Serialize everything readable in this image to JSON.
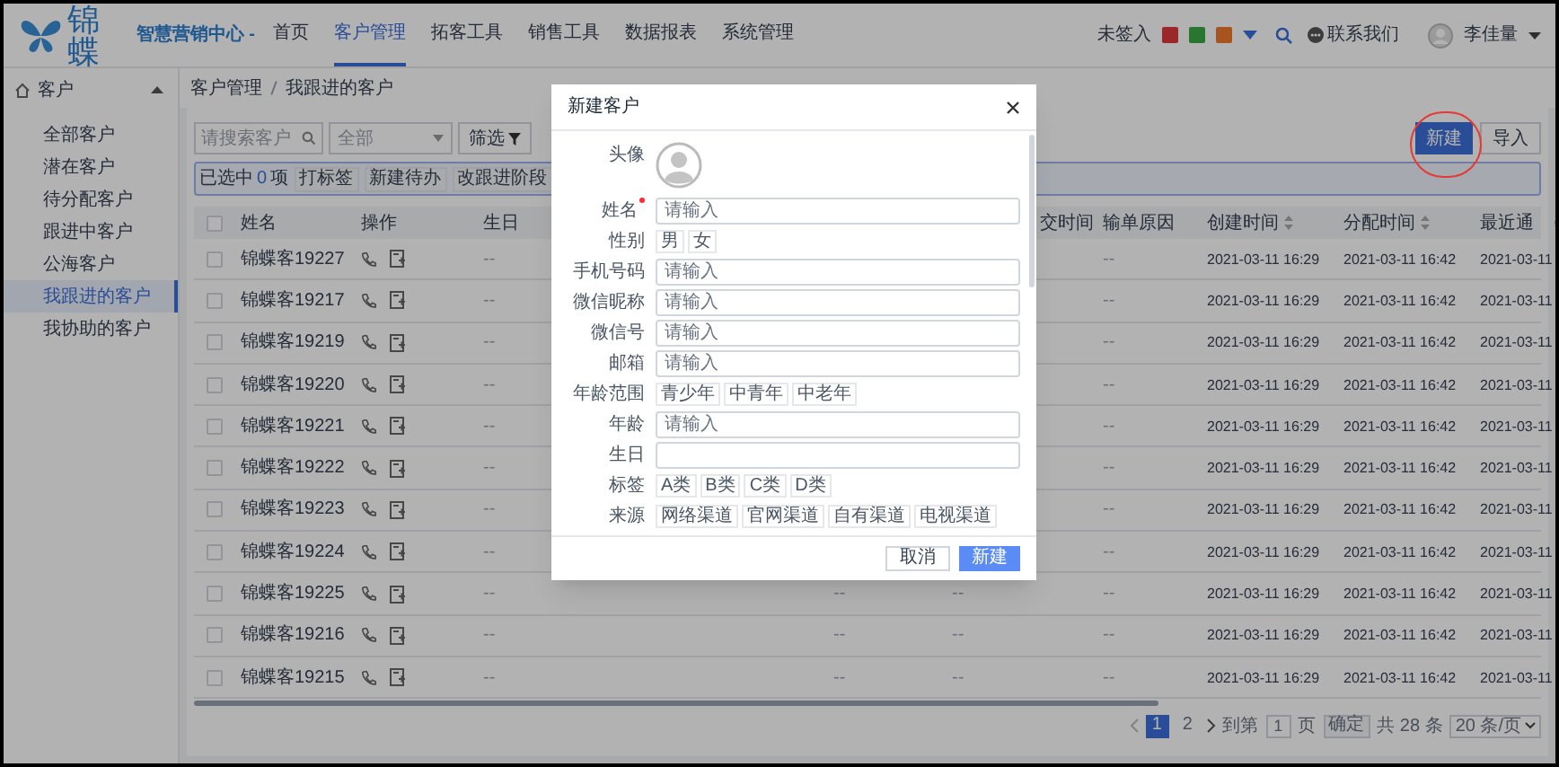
{
  "app": {
    "logo_text": "锦蝶",
    "product": "智慧营销中心 -"
  },
  "nav": [
    {
      "label": "首页",
      "selected": false
    },
    {
      "label": "客户管理",
      "selected": true
    },
    {
      "label": "拓客工具",
      "selected": false
    },
    {
      "label": "销售工具",
      "selected": false
    },
    {
      "label": "数据报表",
      "selected": false
    },
    {
      "label": "系统管理",
      "selected": false
    }
  ],
  "header_right": {
    "sign_status": "未签入",
    "quick_icons": [
      {
        "color": "#9d282b"
      },
      {
        "color": "#297630"
      },
      {
        "color": "#a8551f"
      }
    ],
    "contact": "联系我们",
    "user": "李佳量"
  },
  "sidebar": {
    "title": "客户",
    "expanded": true,
    "items": [
      {
        "label": "全部客户",
        "selected": false
      },
      {
        "label": "潜在客户",
        "selected": false
      },
      {
        "label": "待分配客户",
        "selected": false
      },
      {
        "label": "跟进中客户",
        "selected": false
      },
      {
        "label": "公海客户",
        "selected": false
      },
      {
        "label": "我跟进的客户",
        "selected": true
      },
      {
        "label": "我协助的客户",
        "selected": false
      }
    ]
  },
  "breadcrumb": [
    "客户管理",
    "我跟进的客户"
  ],
  "toolbar": {
    "search_placeholder": "请搜索客户",
    "filter_select": "全部",
    "filter_button": "筛选",
    "buttons": [
      {
        "label": "新建",
        "primary": true
      },
      {
        "label": "导入",
        "primary": false
      }
    ]
  },
  "selection_bar": {
    "prefix": "已选中",
    "count": "0",
    "suffix": "项",
    "actions": [
      "打标签",
      "新建待办",
      "改跟进阶段"
    ]
  },
  "table": {
    "select_all_checked": false,
    "columns": [
      {
        "label": "姓名"
      },
      {
        "label": "操作",
        "kind": "actions"
      },
      {
        "label": "生日"
      },
      {},
      {
        "label": "交时间"
      },
      {
        "label": "输单原因"
      },
      {
        "label": "创建时间",
        "sortable": true
      },
      {
        "label": "分配时间",
        "sortable": true
      },
      {
        "label": "最近通",
        "settings": true
      }
    ],
    "rows": [
      {
        "checked": false,
        "cells": [
          "锦蝶客19227",
          "",
          "--",
          null,
          null,
          "--",
          "2021-03-11 16:29",
          "2021-03-11 16:42",
          "2021-03-11"
        ]
      },
      {
        "checked": false,
        "cells": [
          "锦蝶客19217",
          "",
          "--",
          null,
          null,
          "--",
          "2021-03-11 16:29",
          "2021-03-11 16:42",
          "2021-03-11"
        ]
      },
      {
        "checked": false,
        "cells": [
          "锦蝶客19219",
          "",
          "--",
          null,
          null,
          "--",
          "2021-03-11 16:29",
          "2021-03-11 16:42",
          "2021-03-11"
        ]
      },
      {
        "checked": false,
        "cells": [
          "锦蝶客19220",
          "",
          "--",
          null,
          null,
          "--",
          "2021-03-11 16:29",
          "2021-03-11 16:42",
          "2021-03-11"
        ]
      },
      {
        "checked": false,
        "cells": [
          "锦蝶客19221",
          "",
          "--",
          null,
          null,
          "--",
          "2021-03-11 16:29",
          "2021-03-11 16:42",
          "2021-03-11"
        ]
      },
      {
        "checked": false,
        "cells": [
          "锦蝶客19222",
          "",
          "--",
          null,
          null,
          "--",
          "2021-03-11 16:29",
          "2021-03-11 16:42",
          "2021-03-11"
        ]
      },
      {
        "checked": false,
        "cells": [
          "锦蝶客19223",
          "",
          "--",
          null,
          null,
          "--",
          "2021-03-11 16:29",
          "2021-03-11 16:42",
          "2021-03-11"
        ]
      },
      {
        "checked": false,
        "cells": [
          "锦蝶客19224",
          "",
          "--",
          null,
          null,
          "--",
          "2021-03-11 16:29",
          "2021-03-11 16:42",
          "2021-03-11"
        ]
      },
      {
        "checked": false,
        "cells": [
          "锦蝶客19225",
          "",
          "--",
          "--",
          "--",
          "--",
          "2021-03-11 16:29",
          "2021-03-11 16:42",
          "2021-03-11"
        ]
      },
      {
        "checked": false,
        "cells": [
          "锦蝶客19216",
          "",
          "--",
          "--",
          "--",
          "--",
          "2021-03-11 16:29",
          "2021-03-11 16:42",
          "2021-03-11"
        ]
      },
      {
        "checked": false,
        "cells": [
          "锦蝶客19215",
          "",
          "--",
          "--",
          "--",
          "--",
          "2021-03-11 16:29",
          "2021-03-11 16:42",
          "2021-03-11"
        ]
      }
    ]
  },
  "pagination": {
    "pages": [
      {
        "label": "1",
        "selected": true
      },
      {
        "label": "2",
        "selected": false
      }
    ],
    "goto_label": "到第",
    "goto_value": "1",
    "page_unit": "页",
    "confirm": "确定",
    "total": "共 28 条",
    "page_size": "20 条/页"
  },
  "modal": {
    "title": "新建客户",
    "fields": [
      {
        "kind": "avatar",
        "label": "头像"
      },
      {
        "kind": "input",
        "label": "姓名",
        "required": true,
        "placeholder": "请输入"
      },
      {
        "kind": "chips",
        "label": "性别",
        "options": [
          "男",
          "女"
        ]
      },
      {
        "kind": "input",
        "label": "手机号码",
        "placeholder": "请输入"
      },
      {
        "kind": "input",
        "label": "微信昵称",
        "placeholder": "请输入"
      },
      {
        "kind": "input",
        "label": "微信号",
        "placeholder": "请输入"
      },
      {
        "kind": "input",
        "label": "邮箱",
        "placeholder": "请输入"
      },
      {
        "kind": "chips",
        "label": "年龄范围",
        "options": [
          "青少年",
          "中青年",
          "中老年"
        ]
      },
      {
        "kind": "input",
        "label": "年龄",
        "placeholder": "请输入"
      },
      {
        "kind": "input",
        "label": "生日"
      },
      {
        "kind": "chips",
        "label": "标签",
        "options": [
          "A类",
          "B类",
          "C类",
          "D类"
        ]
      },
      {
        "kind": "chips",
        "label": "来源",
        "options": [
          "网络渠道",
          "官网渠道",
          "自有渠道",
          "电视渠道"
        ]
      }
    ],
    "buttons": [
      {
        "label": "取消",
        "primary": false
      },
      {
        "label": "新建",
        "primary": true
      }
    ]
  }
}
